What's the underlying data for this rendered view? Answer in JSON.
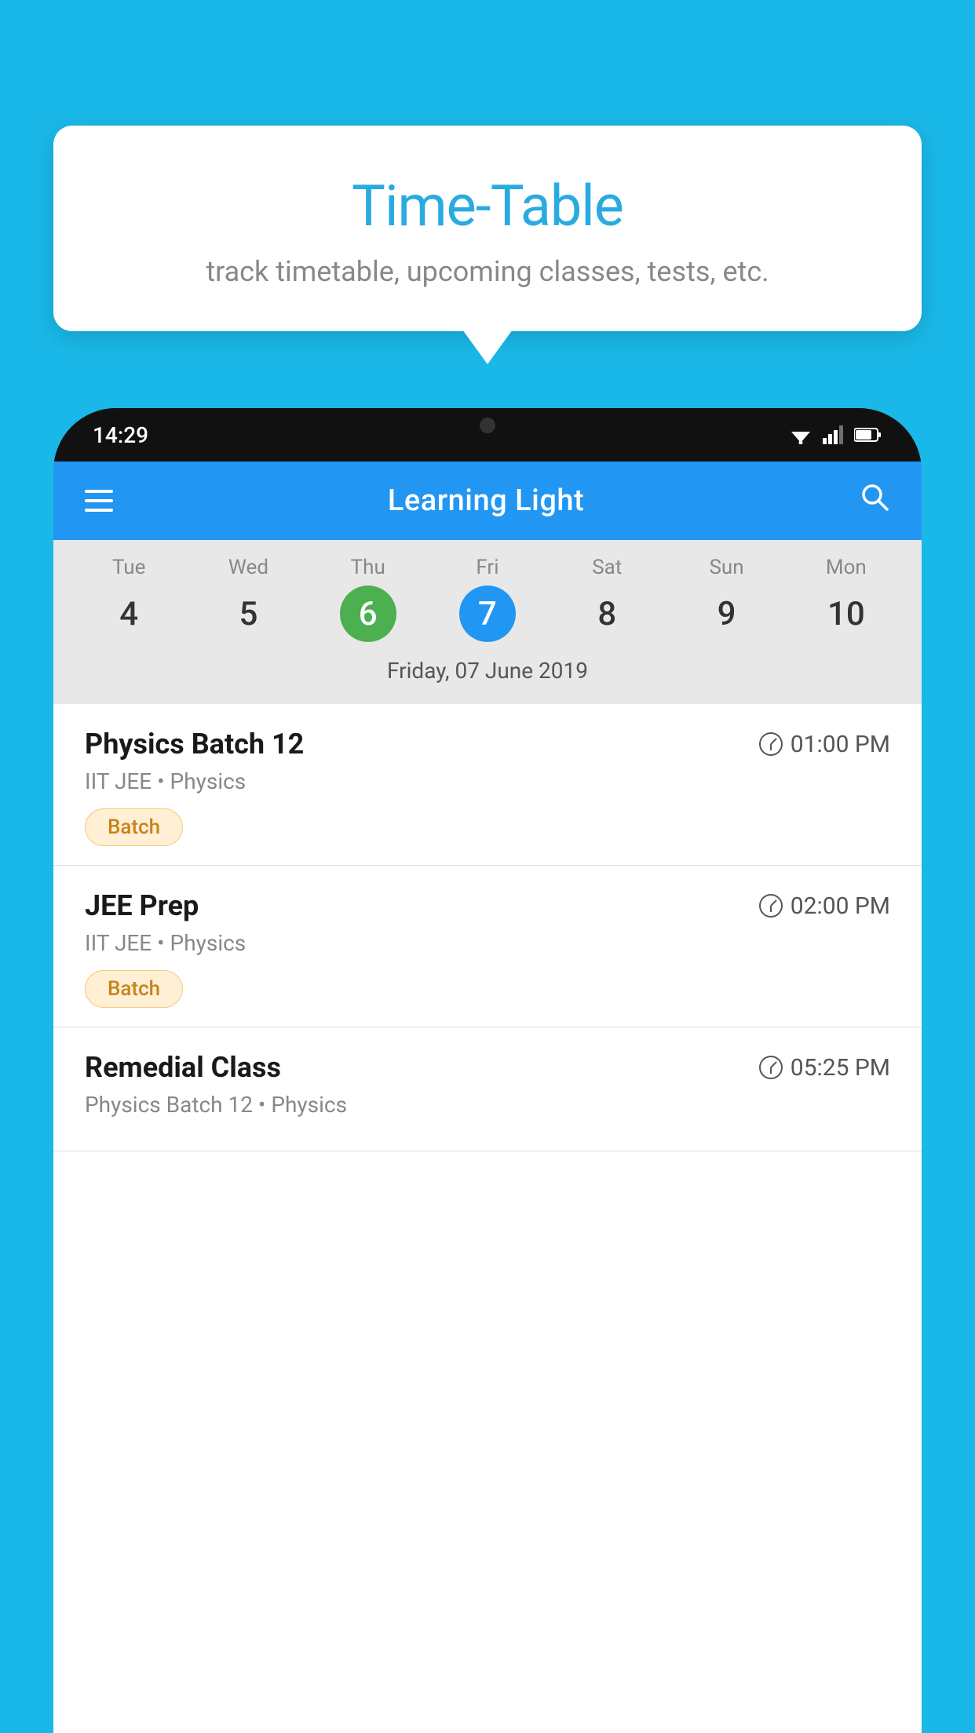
{
  "background_color": "#1ab8e8",
  "tooltip": {
    "title": "Time-Table",
    "subtitle": "track timetable, upcoming classes, tests, etc."
  },
  "phone": {
    "time": "14:29",
    "app_title": "Learning Light",
    "selected_date_label": "Friday, 07 June 2019",
    "days": [
      {
        "name": "Tue",
        "num": "4",
        "state": "normal"
      },
      {
        "name": "Wed",
        "num": "5",
        "state": "normal"
      },
      {
        "name": "Thu",
        "num": "6",
        "state": "today"
      },
      {
        "name": "Fri",
        "num": "7",
        "state": "selected"
      },
      {
        "name": "Sat",
        "num": "8",
        "state": "normal"
      },
      {
        "name": "Sun",
        "num": "9",
        "state": "normal"
      },
      {
        "name": "Mon",
        "num": "10",
        "state": "normal"
      }
    ],
    "schedule": [
      {
        "name": "Physics Batch 12",
        "time": "01:00 PM",
        "meta": "IIT JEE • Physics",
        "tag": "Batch"
      },
      {
        "name": "JEE Prep",
        "time": "02:00 PM",
        "meta": "IIT JEE • Physics",
        "tag": "Batch"
      },
      {
        "name": "Remedial Class",
        "time": "05:25 PM",
        "meta": "Physics Batch 12 • Physics",
        "tag": ""
      }
    ]
  }
}
